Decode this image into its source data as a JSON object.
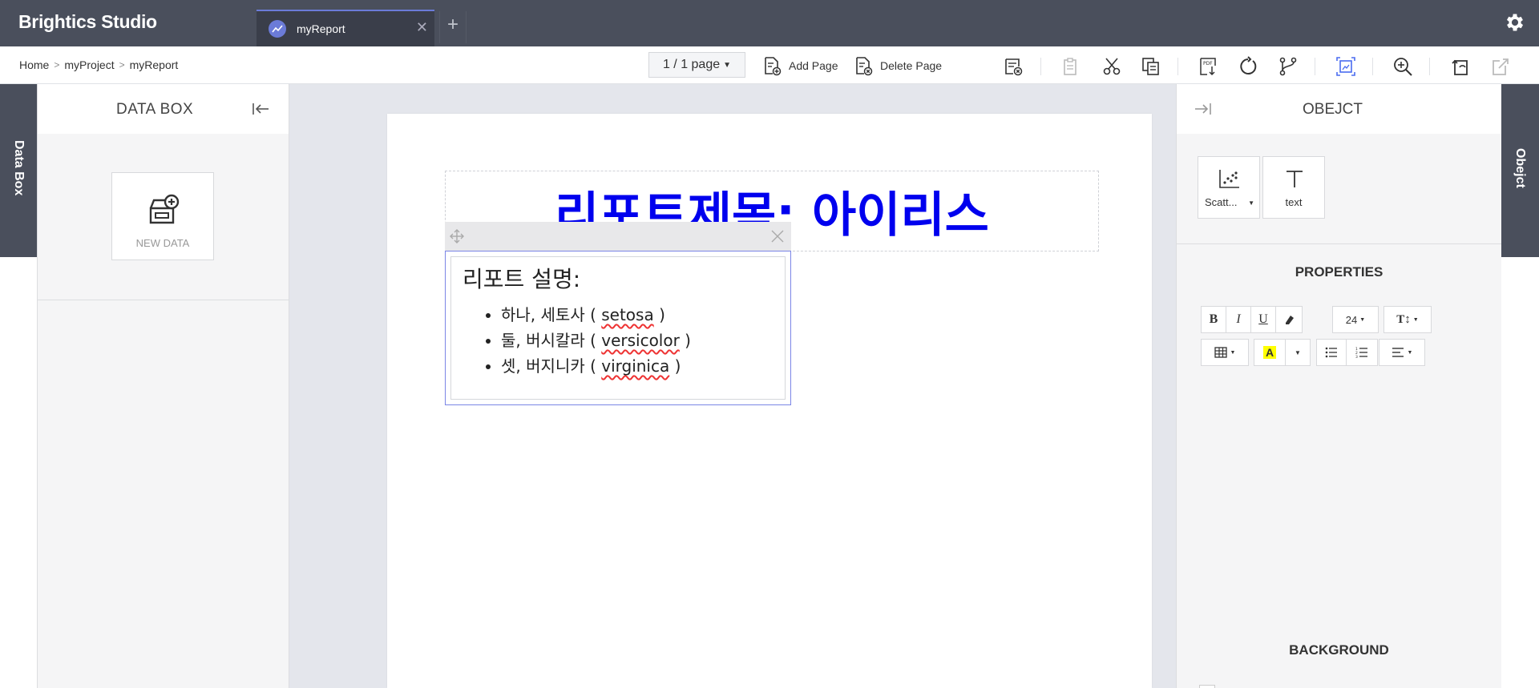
{
  "app": {
    "title": "Brightics Studio"
  },
  "tabs": [
    {
      "label": "myReport",
      "active": true
    }
  ],
  "breadcrumb": [
    "Home",
    "myProject",
    "myReport"
  ],
  "toolbar": {
    "page_select": "1 / 1 page",
    "add_page": "Add Page",
    "delete_page": "Delete Page"
  },
  "left_panel": {
    "strip_label": "Data Box",
    "title": "DATA BOX",
    "new_data": "NEW DATA"
  },
  "report": {
    "title": "리포트제목: 아이리스",
    "description": {
      "heading": "리포트 설명:",
      "items": [
        {
          "prefix": "하나, 세토사 ( ",
          "term": "setosa",
          "suffix": " )"
        },
        {
          "prefix": "둘, 버시칼라 ( ",
          "term": "versicolor",
          "suffix": " )"
        },
        {
          "prefix": "셋, 버지니카 ( ",
          "term": "virginica",
          "suffix": " )"
        }
      ]
    }
  },
  "right_panel": {
    "title": "OBEJCT",
    "strip_label": "Obejct",
    "objects": [
      {
        "label": "Scatt..."
      },
      {
        "label": "text"
      }
    ],
    "properties_title": "PROPERTIES",
    "font_size": "24",
    "background_title": "BACKGROUND"
  },
  "colors": {
    "topbar": "#4a4f5c",
    "accent": "#6b7bd8",
    "title_text": "#0000ee"
  }
}
